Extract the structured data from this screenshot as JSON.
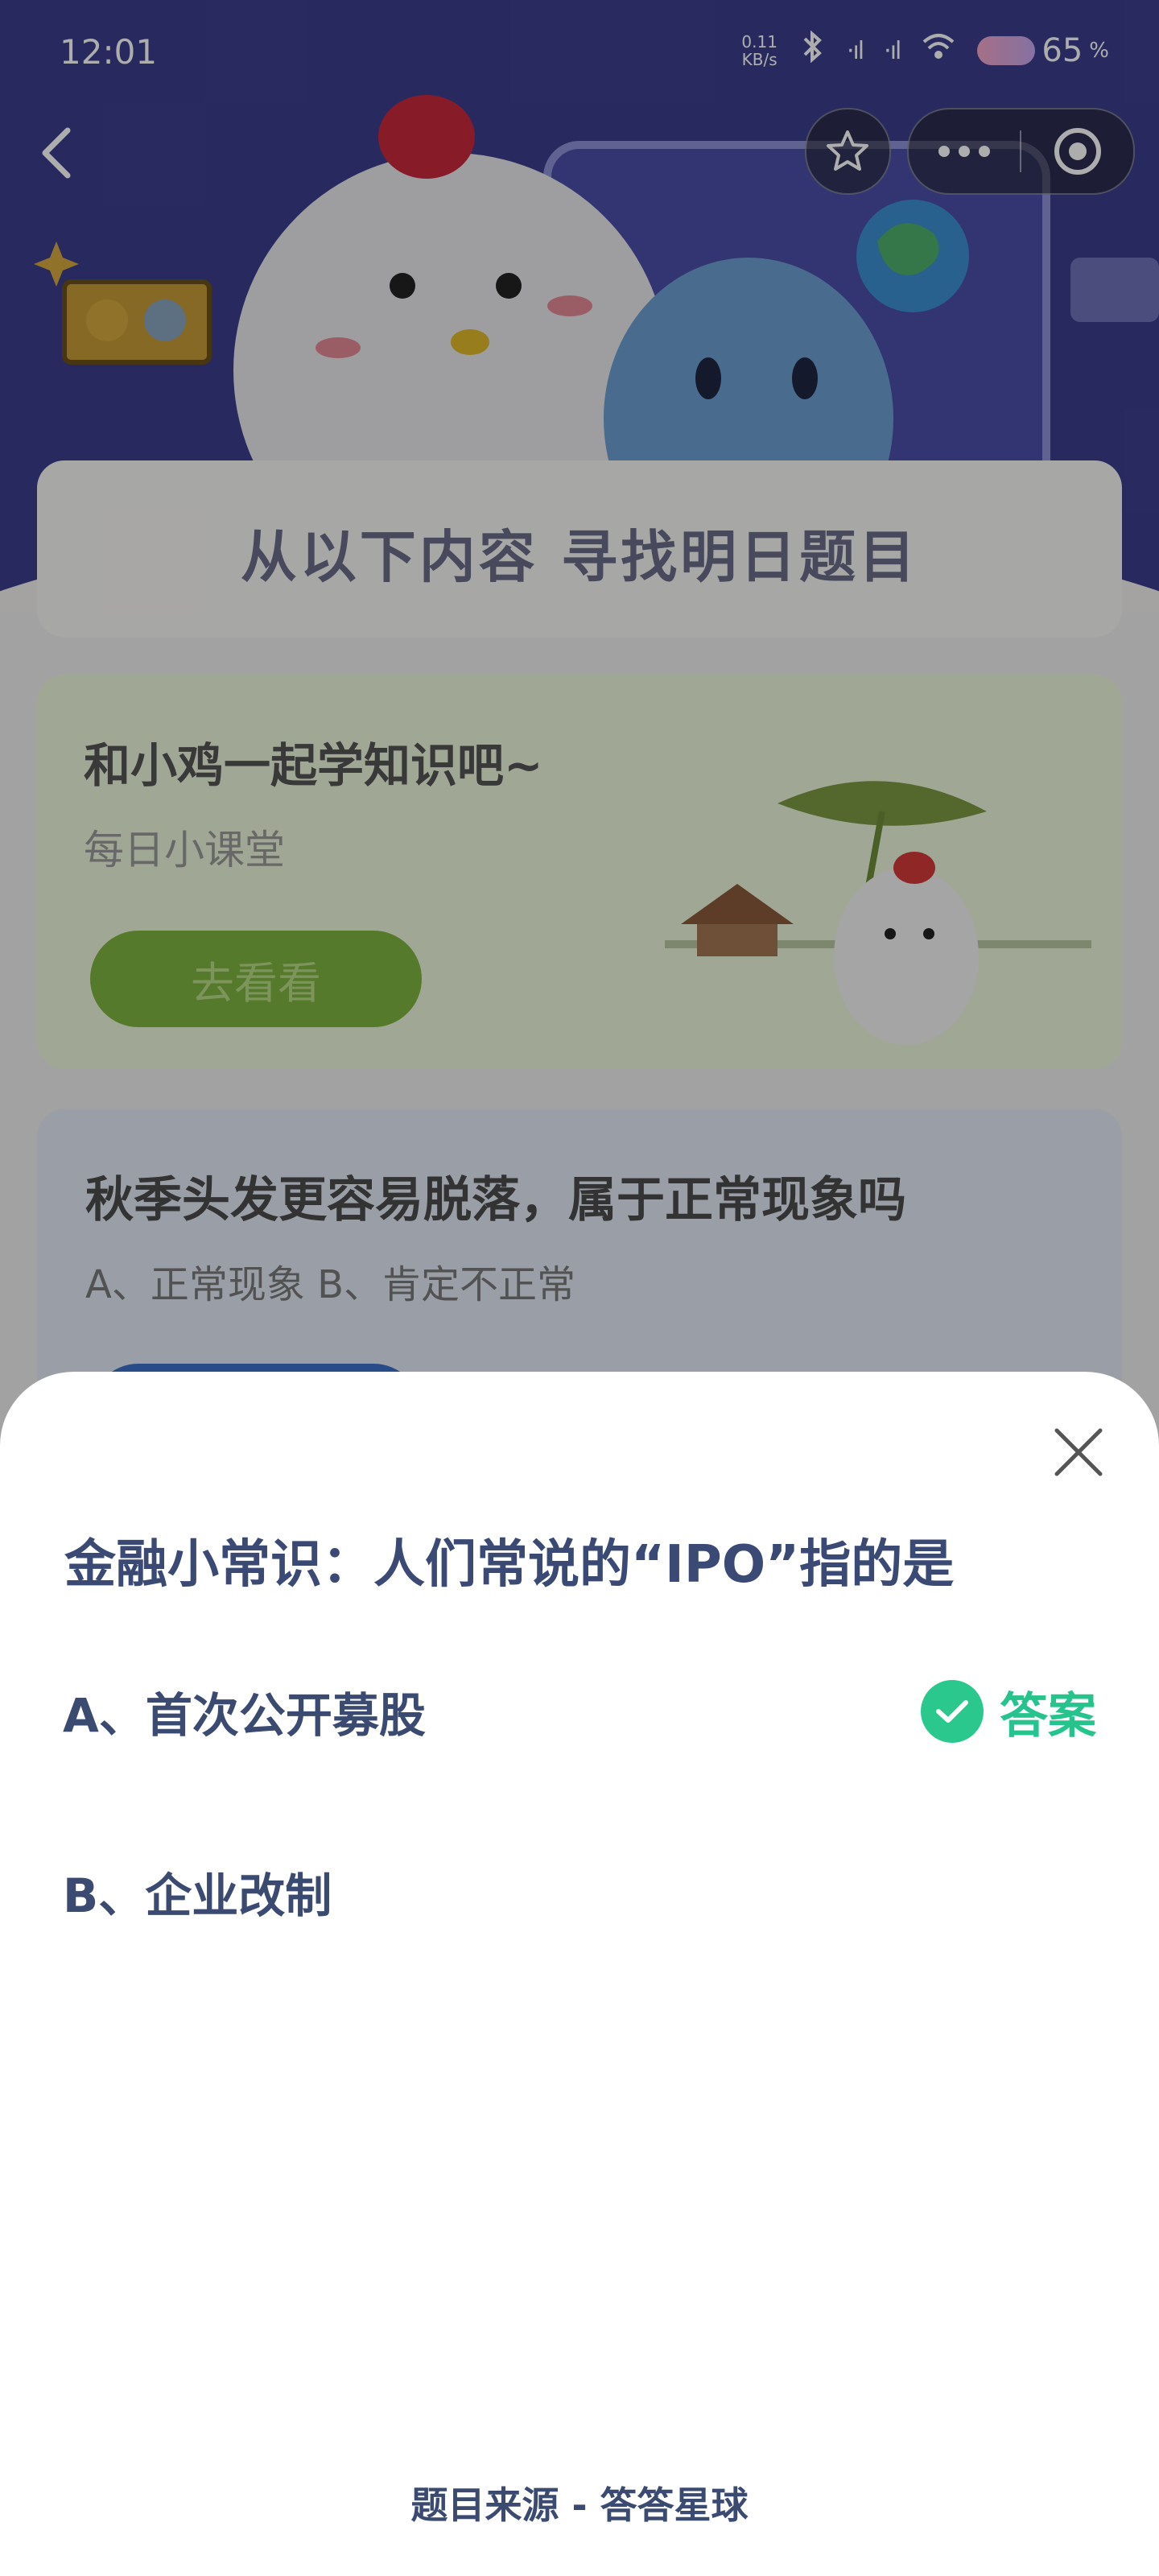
{
  "status_bar": {
    "time": "12:01",
    "net_speed_value": "0.11",
    "net_speed_unit": "KB/s",
    "battery": "65",
    "battery_unit": "%"
  },
  "background": {
    "search_title": "从以下内容  寻找明日题目",
    "lesson_card": {
      "title": "和小鸡一起学知识吧~",
      "subtitle": "每日小课堂",
      "button": "去看看"
    },
    "question_card": {
      "title": "秋季头发更容易脱落，属于正常现象吗",
      "options": "A、正常现象    B、肯定不正常"
    }
  },
  "sheet": {
    "question": "金融小常识：人们常说的“IPO”指的是",
    "option_a": "A、首次公开募股",
    "option_b": "B、企业改制",
    "answer_label": "答案",
    "source": "题目来源 - 答答星球"
  },
  "colors": {
    "hero_bg": "#3c3f8d",
    "answer_green": "#2bc88e",
    "text_navy": "#3b4a70",
    "lesson_button": "#7fb441"
  },
  "icons": [
    "back-icon",
    "star-icon",
    "more-icon",
    "target-icon",
    "close-icon",
    "check-icon",
    "bluetooth-icon",
    "signal-icon",
    "wifi-icon",
    "battery-icon"
  ]
}
